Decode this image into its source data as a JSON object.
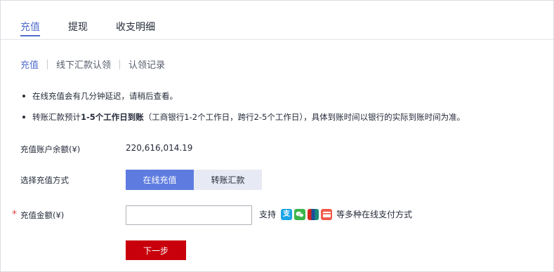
{
  "tabs": [
    {
      "label": "充值",
      "active": true
    },
    {
      "label": "提现",
      "active": false
    },
    {
      "label": "收支明细",
      "active": false
    }
  ],
  "subnav": [
    {
      "label": "充值",
      "active": true
    },
    {
      "label": "线下汇款认领",
      "active": false
    },
    {
      "label": "认领记录",
      "active": false
    }
  ],
  "notes": {
    "note1": "在线充值会有几分钟延迟，请稍后查看。",
    "note2_prefix": "转账汇款预计",
    "note2_bold": "1-5个工作日到账",
    "note2_suffix": "（工商银行1-2个工作日，跨行2-5个工作日），具体到账时间以银行的实际到账时间为准。"
  },
  "balance": {
    "label": "充值账户余额(¥)",
    "value": "220,616,014.19"
  },
  "method": {
    "label": "选择充值方式",
    "options": [
      "在线充值",
      "转账汇款"
    ],
    "selected": "在线充值"
  },
  "amount": {
    "required_mark": "*",
    "label": "充值金额(¥)",
    "value": "",
    "placeholder": ""
  },
  "support": {
    "prefix": "支持",
    "icons": [
      "alipay-icon",
      "wechat-pay-icon",
      "unionpay-icon",
      "bank-card-icon"
    ],
    "suffix": "等多种在线支付方式"
  },
  "next_label": "下一步",
  "colors": {
    "accent": "#526ecc",
    "primary_button": "#5e7ce0",
    "danger_button": "#c7000b",
    "required": "#e54545"
  }
}
